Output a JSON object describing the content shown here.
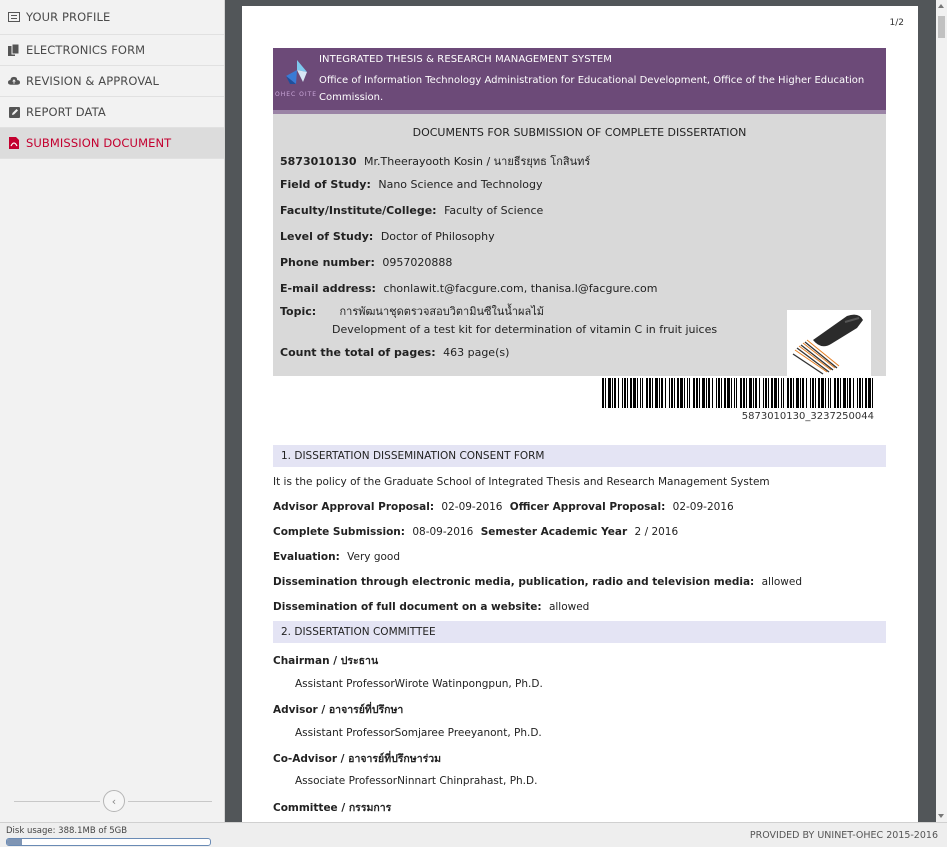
{
  "sidebar": {
    "items": [
      {
        "label": "YOUR PROFILE",
        "icon": "profile-card-icon"
      },
      {
        "label": "ELECTRONICS FORM",
        "icon": "form-document-icon"
      },
      {
        "label": "REVISION & APPROVAL",
        "icon": "cloud-upload-icon"
      },
      {
        "label": "REPORT DATA",
        "icon": "edit-square-icon"
      },
      {
        "label": "SUBMISSION DOCUMENT",
        "icon": "pdf-file-icon",
        "active": true
      }
    ],
    "collapse_icon": "chevron-left-icon"
  },
  "viewer": {
    "page_number": "1/2",
    "header": {
      "system_title": "INTEGRATED THESIS & RESEARCH MANAGEMENT SYSTEM",
      "office": "Office of Information Technology Administration for Educational Development, Office of the Higher Education Commission.",
      "logo_text": "OHEC OITE"
    },
    "info": {
      "title": "DOCUMENTS FOR SUBMISSION OF COMPLETE DISSERTATION",
      "student_id": "5873010130",
      "student_name": "Mr.Theerayooth Kosin / นายธีรยุทธ โกสินทร์",
      "field_label": "Field of Study:",
      "field_value": "Nano Science and Technology",
      "faculty_label": "Faculty/Institute/College:",
      "faculty_value": "Faculty of Science",
      "level_label": "Level of Study:",
      "level_value": "Doctor of Philosophy",
      "phone_label": "Phone number:",
      "phone_value": "0957020888",
      "email_label": "E-mail address:",
      "email_value": "chonlawit.t@facgure.com, thanisa.l@facgure.com",
      "topic_label": "Topic:",
      "topic_thai": "การพัฒนาชุดตรวจสอบวิตามินซีในน้ำผลไม้",
      "topic_english": "Development of a test kit for determination of vitamin C in fruit juices",
      "pages_label": "Count the total of pages:",
      "pages_value": "463 page(s)"
    },
    "barcode_text": "5873010130_3237250044",
    "section1": {
      "title": "1. DISSERTATION DISSEMINATION CONSENT FORM",
      "policy": "It is the policy of the Graduate School of Integrated Thesis and Research Management System",
      "advisor_label": "Advisor Approval Proposal:",
      "advisor_date": "02-09-2016",
      "officer_label": "Officer Approval Proposal:",
      "officer_date": "02-09-2016",
      "complete_label": "Complete Submission:",
      "complete_date": "08-09-2016",
      "semester_label": "Semester Academic Year",
      "semester_value": "2 / 2016",
      "evaluation_label": "Evaluation:",
      "evaluation_value": "Very good",
      "media_label": "Dissemination through electronic media, publication, radio and television media:",
      "media_value": "allowed",
      "website_label": "Dissemination of full document on a website:",
      "website_value": "allowed"
    },
    "section2": {
      "title": "2. DISSERTATION COMMITTEE",
      "chairman_label": "Chairman / ประธาน",
      "chairman_name": "Assistant ProfessorWirote Watinpongpun, Ph.D.",
      "advisor_label": "Advisor / อาจารย์ที่ปรึกษา",
      "advisor_name": "Assistant ProfessorSomjaree Preeyanont, Ph.D.",
      "coadvisor_label": "Co-Advisor / อาจารย์ที่ปรึกษาร่วม",
      "coadvisor_name": "Associate ProfessorNinnart Chinprahast, Ph.D.",
      "committee_label": "Committee / กรรมการ"
    }
  },
  "status": {
    "disk_usage": "Disk usage: 388.1MB of 5GB",
    "disk_fraction": 0.076,
    "credit": "PROVIDED BY UNINET-OHEC 2015-2016"
  },
  "colors": {
    "header_purple": "#6c4a78",
    "active_red": "#c3002f",
    "section_bar": "#e4e4f4"
  }
}
